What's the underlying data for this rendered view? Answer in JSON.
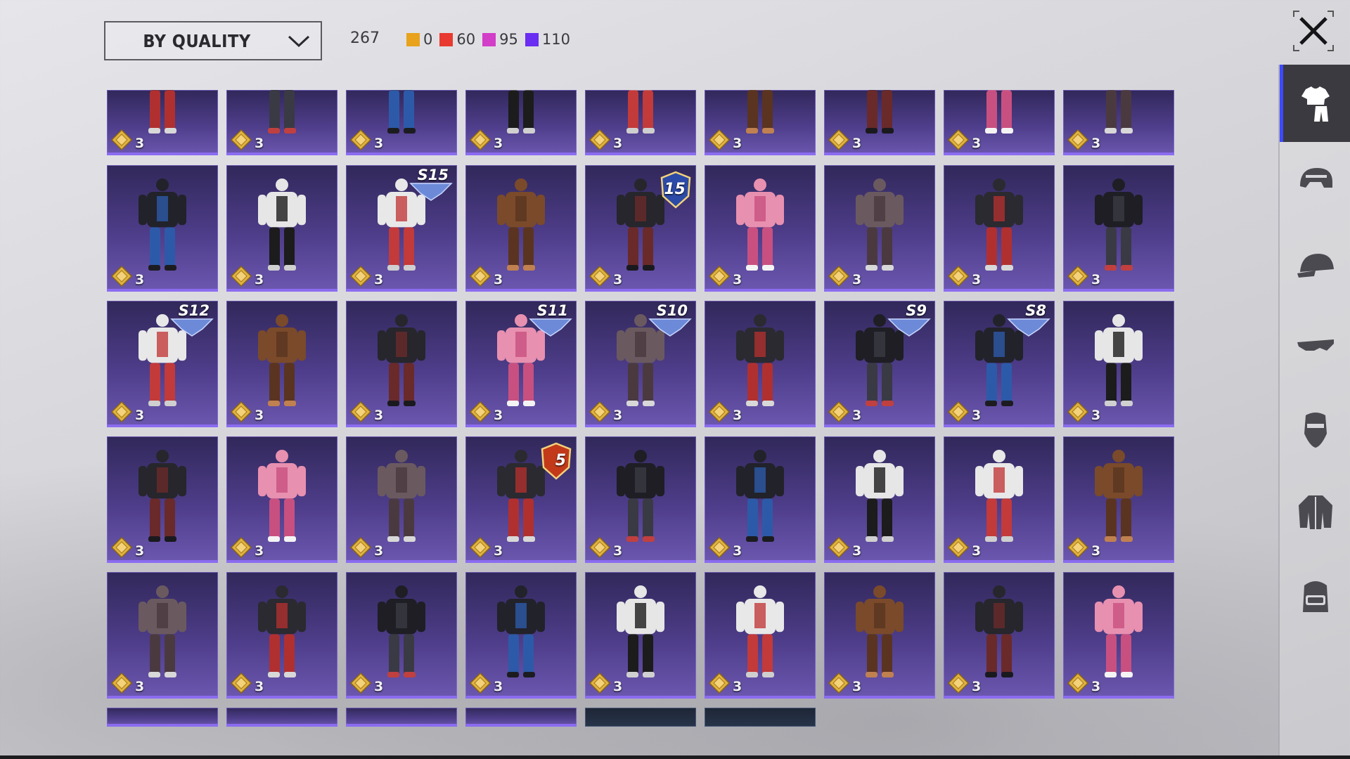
{
  "toolbar": {
    "sort_label": "BY QUALITY",
    "total_count": "267",
    "quality_counts": [
      {
        "color": "#e8a21c",
        "value": "0"
      },
      {
        "color": "#e83a30",
        "value": "60"
      },
      {
        "color": "#d23ec8",
        "value": "95"
      },
      {
        "color": "#6a2df2",
        "value": "110"
      }
    ]
  },
  "grid": {
    "rows": [
      {
        "items": [
          {
            "icon": "outfit-red-shoes-icon",
            "count": "3"
          },
          {
            "icon": "outfit-black-boots-icon",
            "count": "3"
          },
          {
            "icon": "outfit-blue-boots-icon",
            "count": "3"
          },
          {
            "icon": "outfit-white-pants-icon",
            "count": "3"
          },
          {
            "icon": "outfit-white-coat-icon",
            "count": "3"
          },
          {
            "icon": "outfit-brown-boots-icon",
            "count": "3"
          },
          {
            "icon": "outfit-dark-pants-icon",
            "count": "3"
          },
          {
            "icon": "outfit-pink-leggings-icon",
            "count": "3"
          },
          {
            "icon": "outfit-grey-pants-icon",
            "count": "3"
          }
        ]
      },
      {
        "items": [
          {
            "icon": "outfit-blue-hoodie-icon",
            "count": "3"
          },
          {
            "icon": "outfit-teal-jacket-icon",
            "count": "3"
          },
          {
            "icon": "outfit-yellow-coat-icon",
            "count": "3",
            "badge": "S15"
          },
          {
            "icon": "outfit-orange-jumpsuit-icon",
            "count": "3"
          },
          {
            "icon": "outfit-white-armor-icon",
            "count": "3",
            "badge": "15"
          },
          {
            "icon": "outfit-leather-armor-icon",
            "count": "3"
          },
          {
            "icon": "outfit-black-suit-icon",
            "count": "3"
          },
          {
            "icon": "outfit-white-vest-icon",
            "count": "3"
          },
          {
            "icon": "outfit-black-tactical-icon",
            "count": "3"
          }
        ]
      },
      {
        "items": [
          {
            "icon": "outfit-blue-tactical-icon",
            "count": "3",
            "badge": "S12"
          },
          {
            "icon": "outfit-blue-jacket-icon",
            "count": "3"
          },
          {
            "icon": "outfit-white-dress-icon",
            "count": "3"
          },
          {
            "icon": "outfit-red-hood-icon",
            "count": "3",
            "badge": "S11"
          },
          {
            "icon": "outfit-yellow-tactical-icon",
            "count": "3",
            "badge": "S10"
          },
          {
            "icon": "outfit-pink-dress-icon",
            "count": "3"
          },
          {
            "icon": "outfit-dark-hood-icon",
            "count": "3",
            "badge": "S9"
          },
          {
            "icon": "outfit-grey-tactical-icon",
            "count": "3",
            "badge": "S8"
          },
          {
            "icon": "outfit-white-suit-icon",
            "count": "3"
          }
        ]
      },
      {
        "items": [
          {
            "icon": "outfit-white-racer-icon",
            "count": "3"
          },
          {
            "icon": "outfit-brown-coat-icon",
            "count": "3"
          },
          {
            "icon": "outfit-brown-longcoat-icon",
            "count": "3"
          },
          {
            "icon": "outfit-navy-dress-icon",
            "count": "3",
            "badge": "5"
          },
          {
            "icon": "outfit-lab-coat-icon",
            "count": "3"
          },
          {
            "icon": "outfit-maid-dress-icon",
            "count": "3"
          },
          {
            "icon": "outfit-chef-coat-icon",
            "count": "3"
          },
          {
            "icon": "outfit-red-shorts-icon",
            "count": "3"
          },
          {
            "icon": "outfit-black-longcoat-icon",
            "count": "3"
          }
        ]
      },
      {
        "items": [
          {
            "icon": "outfit-yellow-firefighter-icon",
            "count": "3"
          },
          {
            "icon": "outfit-pink-coat-icon",
            "count": "3"
          },
          {
            "icon": "outfit-white-robe-icon",
            "count": "3"
          },
          {
            "icon": "outfit-black-white-suit-icon",
            "count": "3"
          },
          {
            "icon": "outfit-grass-skirt-icon",
            "count": "3"
          },
          {
            "icon": "outfit-football-uniform-icon",
            "count": "3"
          },
          {
            "icon": "outfit-black-ninja-icon",
            "count": "3"
          },
          {
            "icon": "outfit-white-bodysuit-icon",
            "count": "3"
          },
          {
            "icon": "outfit-school-skirt-icon",
            "count": "3"
          }
        ]
      },
      {
        "items": [
          {
            "icon": "outfit-partial-icon"
          },
          {
            "icon": "outfit-partial-icon"
          },
          {
            "icon": "outfit-partial-icon"
          },
          {
            "icon": "outfit-partial-icon"
          },
          {
            "icon": "outfit-partial-icon"
          },
          {
            "icon": "outfit-partial-icon"
          }
        ]
      }
    ]
  },
  "sidebar": {
    "tabs": [
      {
        "icon": "outfit-icon",
        "active": true
      },
      {
        "icon": "helmet-icon",
        "active": false
      },
      {
        "icon": "cap-icon",
        "active": false
      },
      {
        "icon": "glasses-icon",
        "active": false
      },
      {
        "icon": "mask-icon",
        "active": false
      },
      {
        "icon": "jacket-icon",
        "active": false
      },
      {
        "icon": "backpack-icon",
        "active": false
      }
    ]
  },
  "colors": {
    "tile_purple": "#4e3d8a",
    "tile_border": "#8b6cf0",
    "active_tab_accent": "#3d4aff",
    "coin_gold": "#e0b341"
  }
}
